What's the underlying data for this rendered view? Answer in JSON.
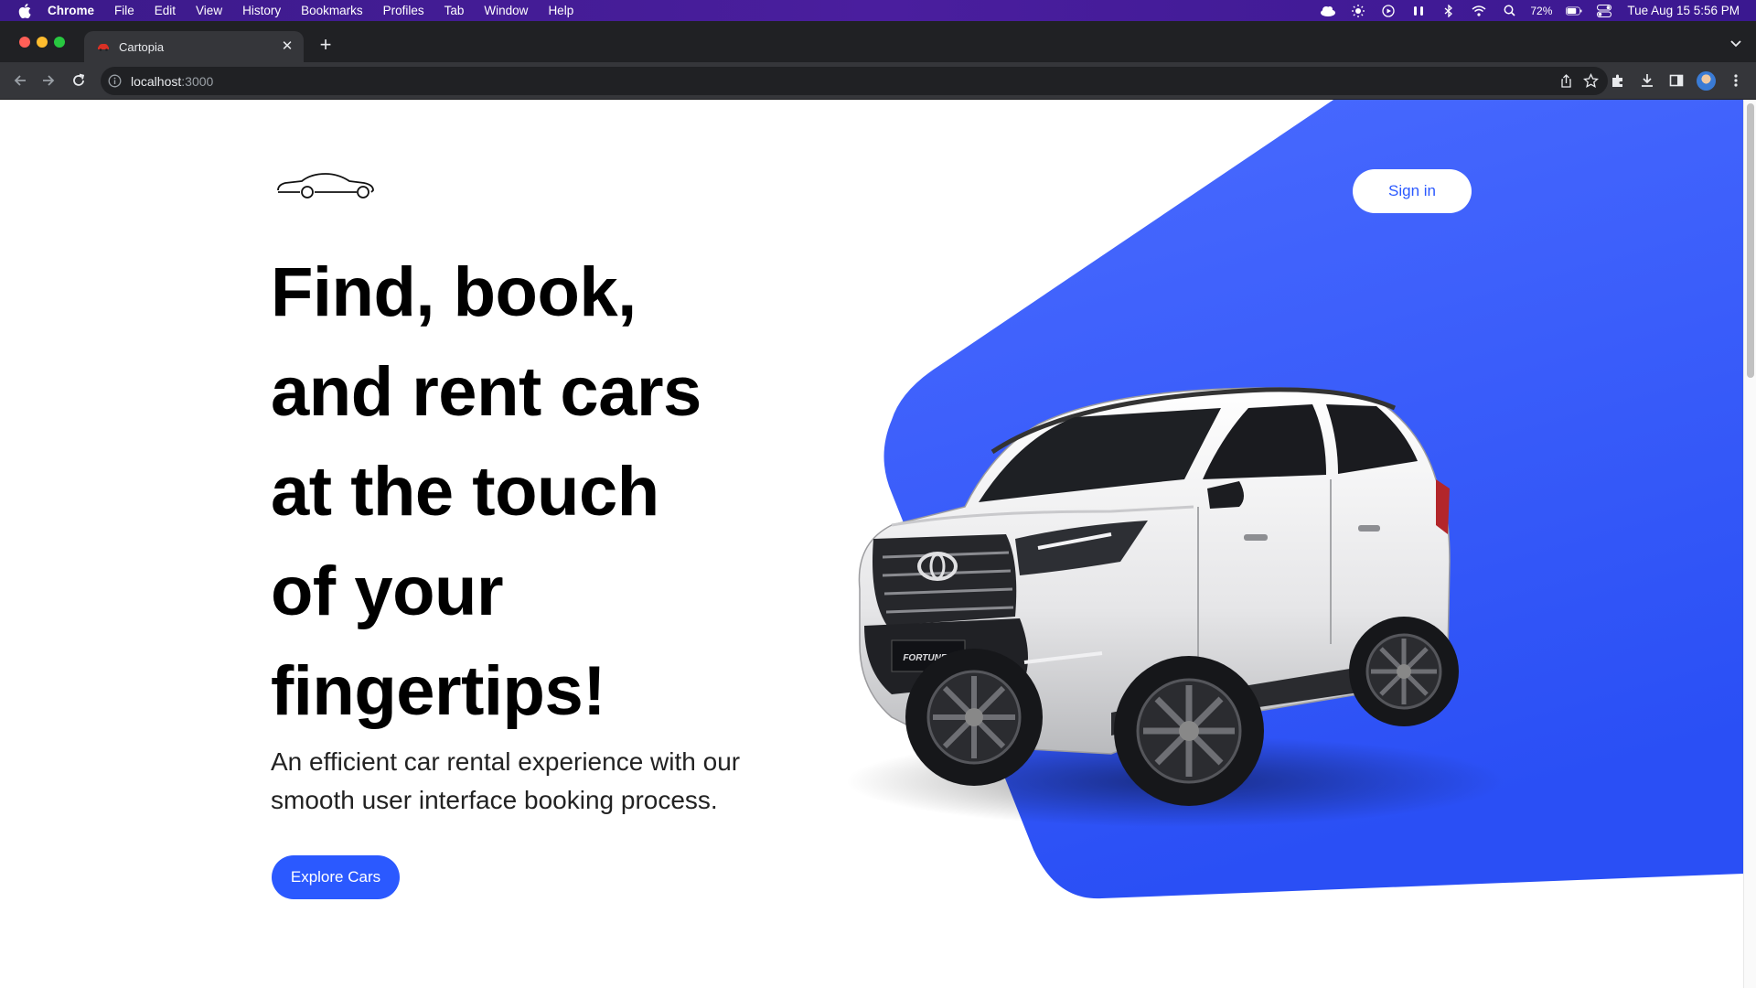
{
  "menubar": {
    "app": "Chrome",
    "items": [
      "File",
      "Edit",
      "View",
      "History",
      "Bookmarks",
      "Profiles",
      "Tab",
      "Window",
      "Help"
    ],
    "battery": "72%",
    "datetime": "Tue Aug 15  5:56 PM"
  },
  "browser": {
    "tab_title": "Cartopia",
    "url_host": "localhost",
    "url_port": ":3000"
  },
  "page": {
    "signin_label": "Sign in",
    "headline": [
      "Find, book,",
      "and rent cars",
      "at the touch",
      "of your",
      "fingertips!"
    ],
    "subtitle": "An efficient car rental experience with our smooth user interface booking process.",
    "cta_label": "Explore Cars",
    "car_badge": "FORTUNER",
    "accent_color": "#2b59ff"
  }
}
